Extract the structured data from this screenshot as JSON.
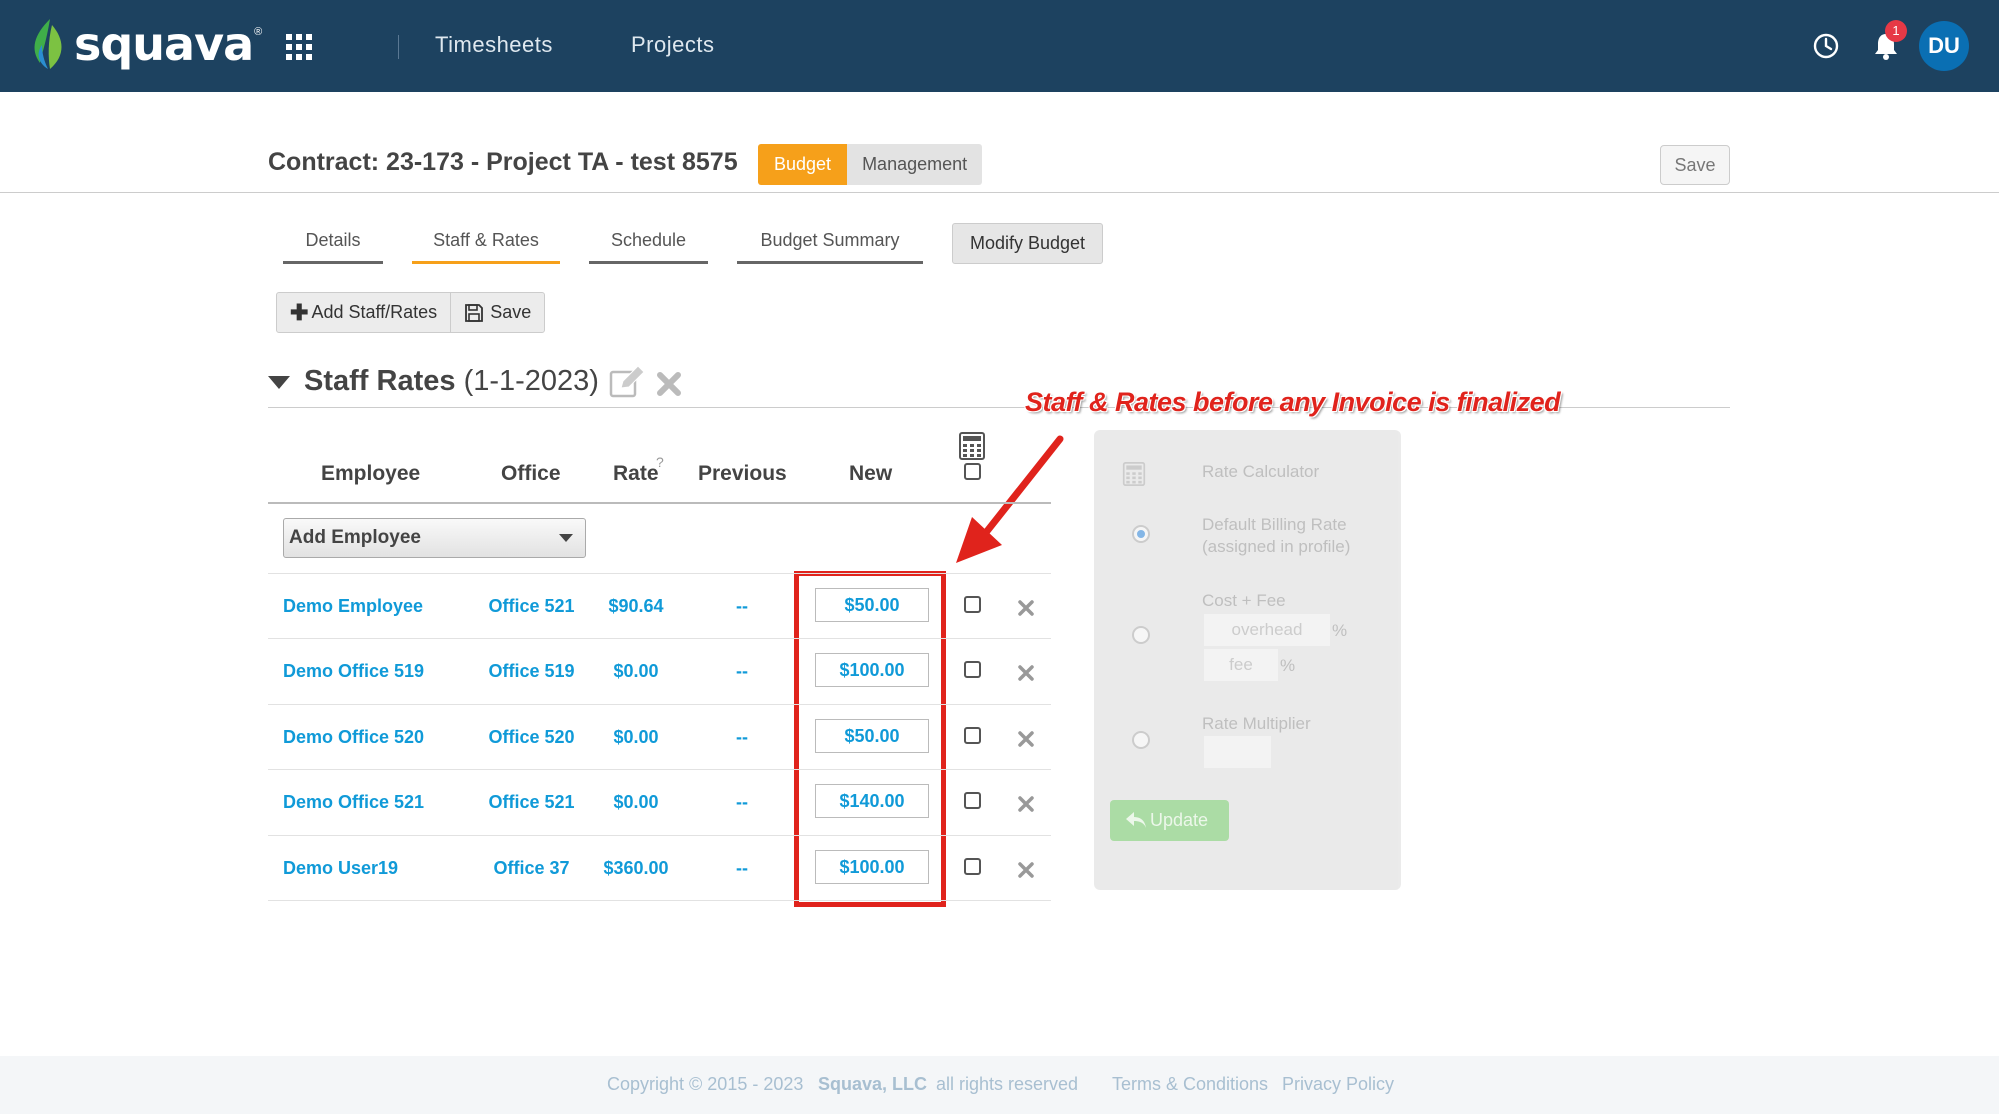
{
  "nav": {
    "logo_text": "squava",
    "logo_reg": "®",
    "links": [
      "Timesheets",
      "Projects"
    ],
    "notification_count": "1",
    "avatar_initials": "DU",
    "brand_color": "#1d4260"
  },
  "header": {
    "contract_title": "Contract: 23-173 - Project TA - test 8575",
    "budget_label": "Budget",
    "management_label": "Management",
    "save_label": "Save"
  },
  "tabs": [
    {
      "label": "Details",
      "active": false
    },
    {
      "label": "Staff & Rates",
      "active": true
    },
    {
      "label": "Schedule",
      "active": false
    },
    {
      "label": "Budget Summary",
      "active": false
    }
  ],
  "modify_budget_label": "Modify Budget",
  "toolbar": {
    "add_label": "Add Staff/Rates",
    "save_label": "Save"
  },
  "section": {
    "title": "Staff Rates",
    "date": "(1-1-2023)"
  },
  "annotation": {
    "text": "Staff & Rates before any Invoice is finalized",
    "color": "#e0231c"
  },
  "table": {
    "headers": {
      "employee": "Employee",
      "office": "Office",
      "rate": "Rate",
      "rate_help": "?",
      "previous": "Previous",
      "new": "New"
    },
    "add_employee_label": "Add Employee",
    "rows": [
      {
        "employee": "Demo Employee",
        "office": "Office 521",
        "rate": "$90.64",
        "previous": "--",
        "new": "$50.00"
      },
      {
        "employee": "Demo Office 519",
        "office": "Office 519",
        "rate": "$0.00",
        "previous": "--",
        "new": "$100.00"
      },
      {
        "employee": "Demo Office 520",
        "office": "Office 520",
        "rate": "$0.00",
        "previous": "--",
        "new": "$50.00"
      },
      {
        "employee": "Demo Office 521",
        "office": "Office 521",
        "rate": "$0.00",
        "previous": "--",
        "new": "$140.00"
      },
      {
        "employee": "Demo User19",
        "office": "Office 37",
        "rate": "$360.00",
        "previous": "--",
        "new": "$100.00"
      }
    ]
  },
  "calculator": {
    "title": "Rate Calculator",
    "default_billing_line1": "Default Billing Rate",
    "default_billing_line2": "(assigned in profile)",
    "cost_fee_label": "Cost + Fee",
    "overhead_placeholder": "overhead",
    "fee_placeholder": "fee",
    "percent": "%",
    "multiplier_label": "Rate Multiplier",
    "update_label": "Update",
    "selected_option": "Default Billing Rate"
  },
  "footer": {
    "copyright": "Copyright © 2015 - 2023",
    "company": "Squava, LLC",
    "rights": "all rights reserved",
    "terms": "Terms & Conditions",
    "privacy": "Privacy Policy"
  }
}
